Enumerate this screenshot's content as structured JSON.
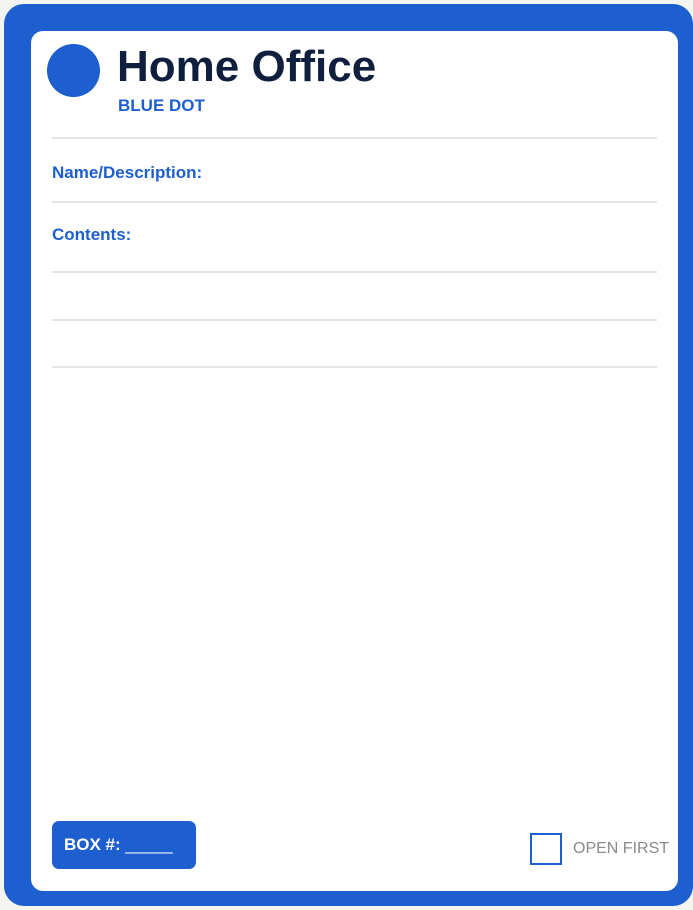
{
  "label": {
    "title": "Home Office",
    "color_code": "BLUE DOT",
    "dot_color": "#1d5fcf",
    "fields": {
      "name_description": "Name/Description:",
      "contents": "Contents:"
    },
    "box_number": {
      "label": "BOX #:",
      "blank": "_____"
    },
    "open_first": {
      "label": "OPEN FIRST",
      "checked": false
    }
  },
  "colors": {
    "accent": "#1d5fcf",
    "title_text": "#0f1f3d",
    "rule": "#e4e4e4",
    "muted_text": "#8a8a8a"
  }
}
